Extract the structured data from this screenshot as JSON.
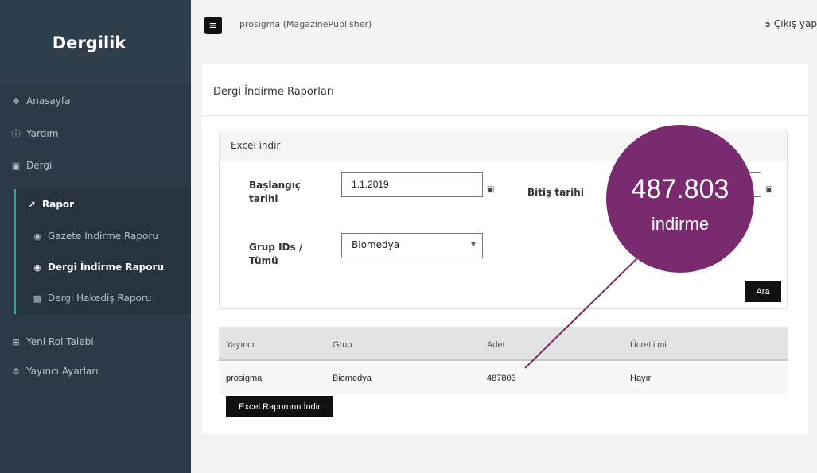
{
  "sidebar": {
    "brand": "Dergilik",
    "items": [
      {
        "label": "Anasayfa",
        "icon": "home-icon"
      },
      {
        "label": "Yardım",
        "icon": "help-icon"
      },
      {
        "label": "Dergi",
        "icon": "book-icon"
      },
      {
        "label": "Rapor",
        "icon": "chart-icon"
      },
      {
        "label": "Gazete İndirme Raporu",
        "icon": "circle-icon"
      },
      {
        "label": "Dergi İndirme Raporu",
        "icon": "circle-icon"
      },
      {
        "label": "Dergi Hakediş Raporu",
        "icon": "money-icon"
      },
      {
        "label": "Yeni Rol Talebi",
        "icon": "plus-square-icon"
      },
      {
        "label": "Yayıncı Ayarları",
        "icon": "gear-icon"
      }
    ]
  },
  "topbar": {
    "user": "prosigma (MagazinePublisher)",
    "logout": "Çıkış yap"
  },
  "page": {
    "title": "Dergi İndirme Raporları"
  },
  "filter": {
    "header": "Excel indir",
    "start_label": "Başlangıç tarihi",
    "start_value": "1.1.2019",
    "end_label": "Bitiş tarihi",
    "end_value": "",
    "group_label": "Grup IDs / Tümü",
    "group_value": "Biomedya",
    "search_button": "Ara"
  },
  "table": {
    "columns": [
      "Yayıncı",
      "Grup",
      "Adet",
      "Ücretli mi"
    ],
    "rows": [
      [
        "prosigma",
        "Biomedya",
        "487803",
        "Hayır"
      ]
    ]
  },
  "export_button": "Excel Raporunu İndir",
  "callout": {
    "number": "487.803",
    "label": "indirme",
    "color": "#7a2a6e"
  },
  "colors": {
    "sidebar": "#2b3a46",
    "accent": "#3aa58c"
  }
}
